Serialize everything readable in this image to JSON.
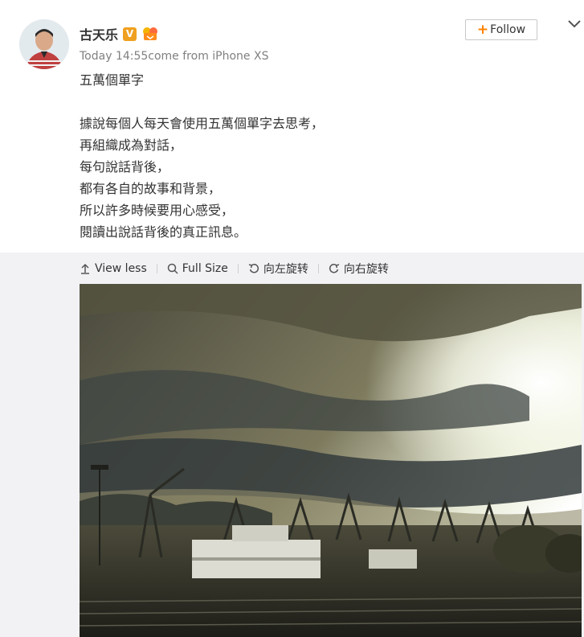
{
  "author": {
    "name": "古天乐"
  },
  "post": {
    "meta": "Today 14:55come from iPhone XS",
    "title": "五萬個單字",
    "lines": [
      "據說每個人每天會使用五萬個單字去思考，",
      "再組織成為對話，",
      "每句說話背後，",
      "都有各自的故事和背景，",
      "所以許多時候要用心感受，",
      "閱讀出說話背後的真正訊息。"
    ]
  },
  "actions": {
    "follow_label": "Follow"
  },
  "media_toolbar": {
    "view_less": "View less",
    "full_size": "Full Size",
    "rotate_left": "向左旋转",
    "rotate_right": "向右旋转"
  },
  "icons": [
    "verified-v-icon",
    "fan-badge-icon",
    "plus-icon",
    "chevron-down-icon",
    "arrow-up-icon",
    "search-icon",
    "rotate-left-icon",
    "rotate-right-icon"
  ],
  "colors": {
    "accent": "#ff8200",
    "badge": "#f0a020",
    "text": "#333333",
    "muted": "#808080",
    "media_bg": "#f2f2f5"
  }
}
